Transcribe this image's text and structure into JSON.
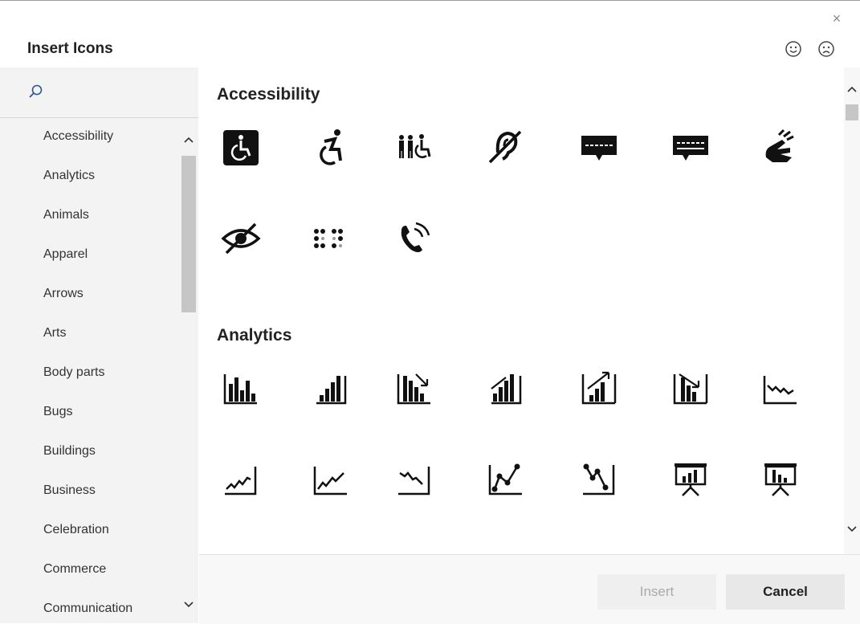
{
  "dialog": {
    "title": "Insert Icons",
    "close_glyph": "×",
    "feedback_icons": [
      "smile-icon",
      "frown-icon"
    ]
  },
  "search": {
    "placeholder": ""
  },
  "categories": [
    "Accessibility",
    "Analytics",
    "Animals",
    "Apparel",
    "Arrows",
    "Arts",
    "Body parts",
    "Bugs",
    "Buildings",
    "Business",
    "Celebration",
    "Commerce",
    "Communication"
  ],
  "sections": [
    {
      "title": "Accessibility",
      "icons": [
        "wheelchair-sign-icon",
        "active-wheelchair-icon",
        "family-accessible-icon",
        "hearing-impaired-icon",
        "closed-captioning-icon",
        "captioning-icon",
        "sign-language-icon",
        "visually-impaired-icon",
        "braille-icon",
        "telephone-volume-icon"
      ]
    },
    {
      "title": "Analytics",
      "icons": [
        "bar-chart-icon",
        "bar-chart-ascending-icon",
        "bar-chart-descending-icon",
        "bar-chart-ascending-steps-icon",
        "bar-chart-up-arrow-icon",
        "bar-chart-down-arrow-icon",
        "line-chart-downward-icon",
        "line-chart-upward-icon",
        "line-chart-upward-trend-icon",
        "line-chart-downward-trend-icon",
        "line-chart-points-up-icon",
        "line-chart-points-down-icon",
        "presentation-bar-chart-icon",
        "presentation-chart-icon"
      ]
    }
  ],
  "footer": {
    "insert_label": "Insert",
    "cancel_label": "Cancel"
  }
}
